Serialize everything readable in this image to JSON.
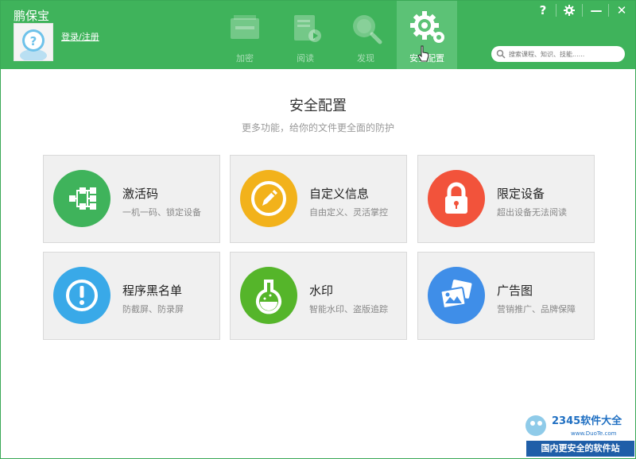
{
  "app": {
    "title": "鹏保宝",
    "login_link": "登录/注册"
  },
  "nav": {
    "tabs": [
      {
        "id": "encrypt",
        "label": "加密",
        "active": false
      },
      {
        "id": "read",
        "label": "阅读",
        "active": false
      },
      {
        "id": "discover",
        "label": "发现",
        "active": false
      },
      {
        "id": "config",
        "label": "安全配置",
        "active": true
      }
    ]
  },
  "window_controls": {
    "help": "?",
    "settings_icon": "gear-icon",
    "minimize": "—",
    "close": "✕"
  },
  "search": {
    "placeholder": "搜索课程、知识、技能......"
  },
  "main": {
    "title": "安全配置",
    "subtitle": "更多功能，给你的文件更全面的防护",
    "cards": [
      {
        "title": "激活码",
        "subtitle": "一机一码、锁定设备",
        "icon": "network-icon",
        "color": "#3fb35b"
      },
      {
        "title": "自定义信息",
        "subtitle": "自由定义、灵活掌控",
        "icon": "edit-icon",
        "color": "#f2b21b"
      },
      {
        "title": "限定设备",
        "subtitle": "超出设备无法阅读",
        "icon": "lock-icon",
        "color": "#f2533b"
      },
      {
        "title": "程序黑名单",
        "subtitle": "防截屏、防录屏",
        "icon": "alert-icon",
        "color": "#39a9e8"
      },
      {
        "title": "水印",
        "subtitle": "智能水印、盗版追踪",
        "icon": "flask-icon",
        "color": "#55b52a"
      },
      {
        "title": "广告图",
        "subtitle": "营销推广、品牌保障",
        "icon": "images-icon",
        "color": "#3f8ee8"
      }
    ]
  },
  "watermark": {
    "logo": "2345软件大全",
    "url": "www.DuoTe.com",
    "slogan": "国内更安全的软件站"
  }
}
